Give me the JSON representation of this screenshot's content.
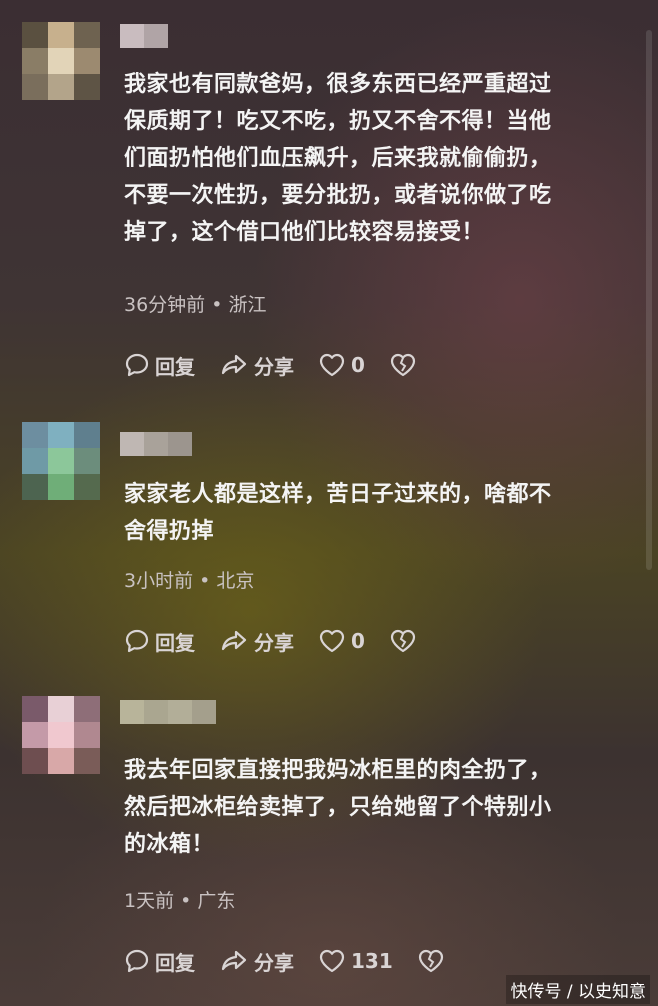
{
  "comments": [
    {
      "text": "我家也有同款爸妈，很多东西已经严重超过保质期了！吃又不吃，扔又不舍不得！当他们面扔怕他们血压飙升，后来我就偷偷扔，不要一次性扔，要分批扔，或者说你做了吃掉了，这个借口他们比较容易接受！",
      "lines": [
        "我家也有同款爸妈，很多东西已经严重超过",
        "保质期了！吃又不吃，扔又不舍不得！当他",
        "们面扔怕他们血压飙升，后来我就偷偷扔，",
        "不要一次性扔，要分批扔，或者说你做了吃",
        "掉了，这个借口他们比较容易接受！"
      ],
      "time": "36分钟前",
      "location": "浙江",
      "reply_label": "回复",
      "share_label": "分享",
      "likes": "0"
    },
    {
      "lines": [
        "家家老人都是这样，苦日子过来的，啥都不",
        "舍得扔掉"
      ],
      "time": "3小时前",
      "location": "北京",
      "reply_label": "回复",
      "share_label": "分享",
      "likes": "0"
    },
    {
      "lines": [
        "我去年回家直接把我妈冰柜里的肉全扔了，",
        "然后把冰柜给卖掉了，只给她留了个特别小",
        "的冰箱！"
      ],
      "time": "1天前",
      "location": "广东",
      "reply_label": "回复",
      "share_label": "分享",
      "likes": "131"
    }
  ],
  "meta_separator": " • ",
  "watermark": "快传号 / 以史知意",
  "icons": {
    "reply": "speech-bubble-icon",
    "share": "share-arrow-icon",
    "like": "heart-icon",
    "dislike": "broken-heart-icon"
  },
  "colors": {
    "text": "#f4f4f4",
    "meta": "#c9c2c2",
    "action": "#d9d4d4"
  }
}
